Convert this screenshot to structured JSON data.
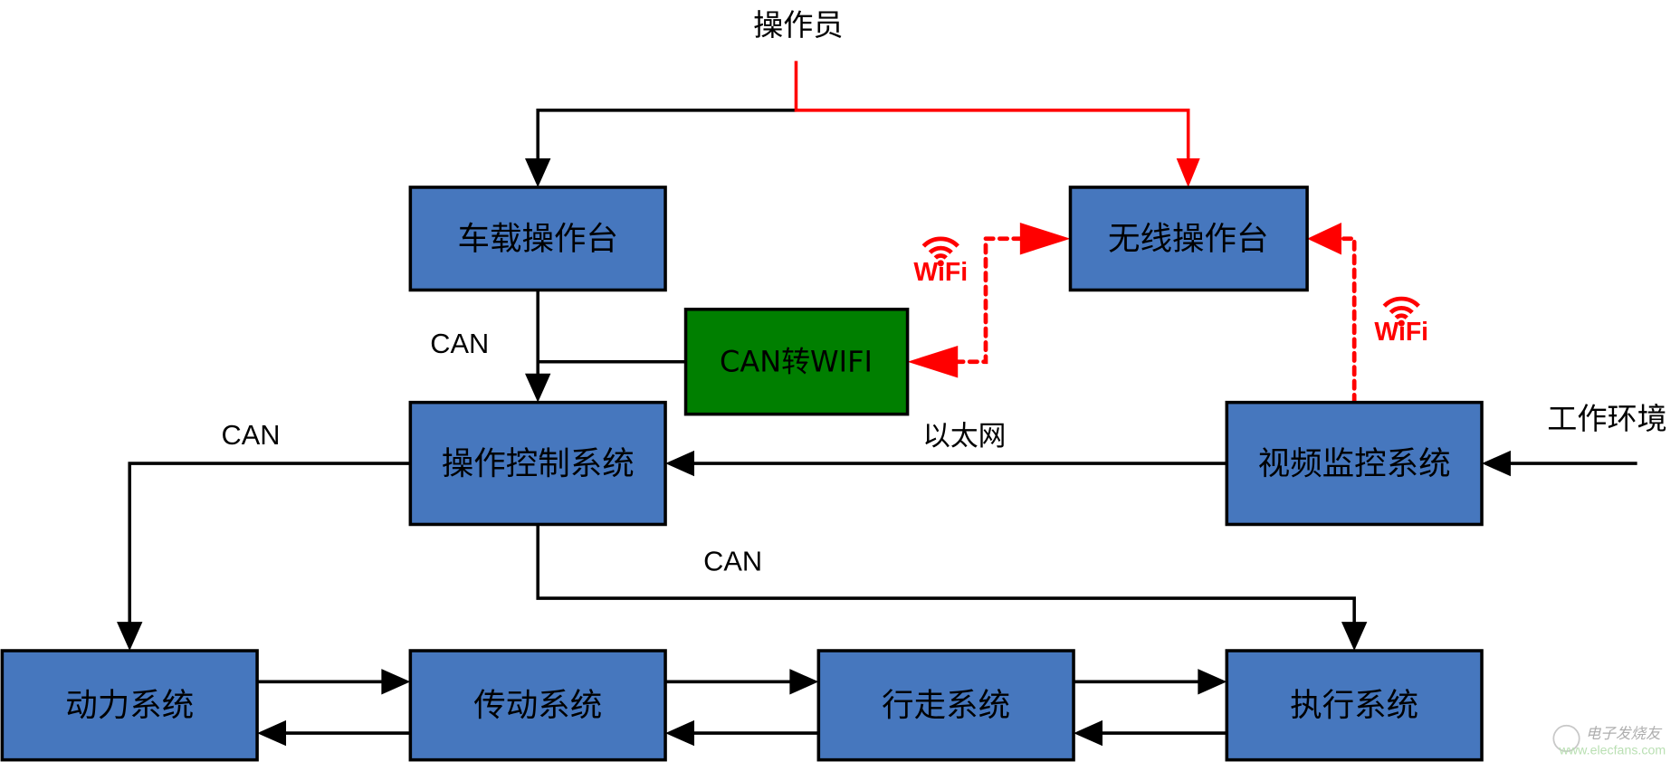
{
  "diagram": {
    "title_node": "操作员",
    "environment_node": "工作环境",
    "nodes": {
      "vehicle_console": "车载操作台",
      "wireless_console": "无线操作台",
      "can_to_wifi": "CAN转WIFI",
      "control_system": "操作控制系统",
      "video_monitor": "视频监控系统",
      "power_system": "动力系统",
      "transmission_system": "传动系统",
      "walking_system": "行走系统",
      "execution_system": "执行系统"
    },
    "edge_labels": {
      "can_vertical": "CAN",
      "can_left": "CAN",
      "can_bottom": "CAN",
      "ethernet": "以太网",
      "wifi_left": "WiFi",
      "wifi_right": "WiFi"
    },
    "watermark": {
      "brand": "电子发烧友",
      "url": "www.elecfans.com"
    },
    "colors": {
      "box_blue": "#4677be",
      "box_green": "#007f00",
      "wireless_red": "#ff0000",
      "wired_black": "#000000"
    }
  }
}
